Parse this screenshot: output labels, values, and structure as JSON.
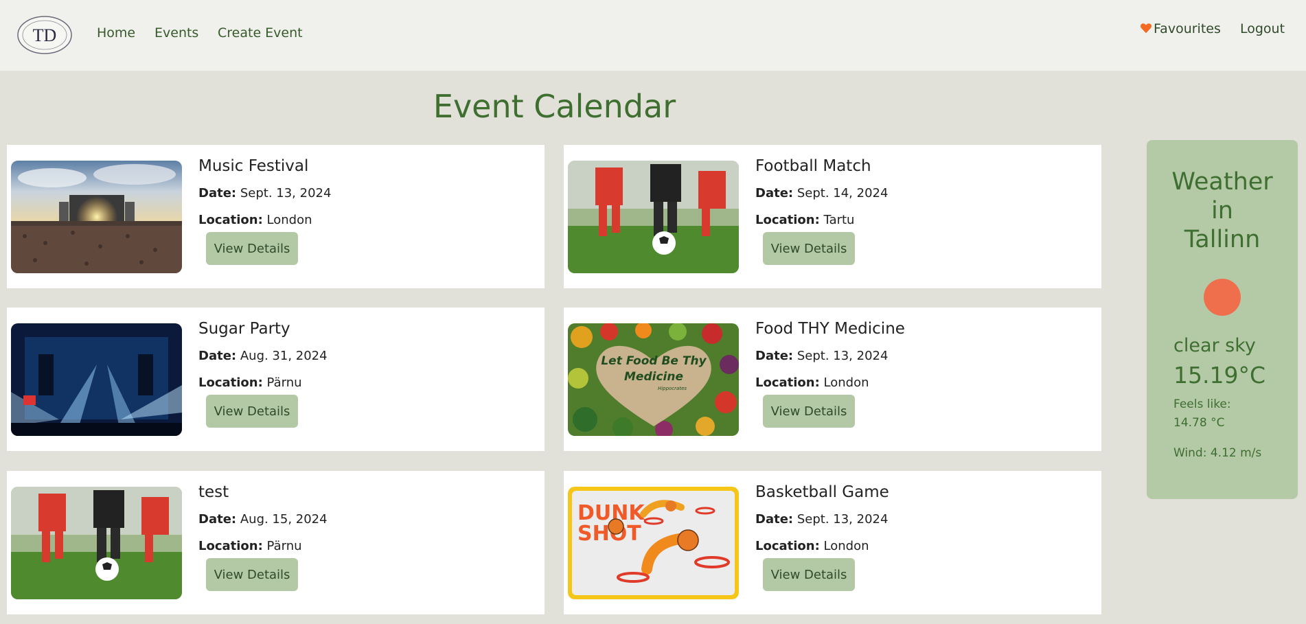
{
  "nav": {
    "logo_text": "TD",
    "links": [
      "Home",
      "Events",
      "Create Event"
    ],
    "favourites": "Favourites",
    "logout": "Logout"
  },
  "page_title": "Event Calendar",
  "labels": {
    "date": "Date:",
    "location": "Location:",
    "button": "View Details"
  },
  "events": [
    {
      "title": "Music Festival",
      "date": "Sept. 13, 2024",
      "location": "London",
      "image": "concert-crowd"
    },
    {
      "title": "Football Match",
      "date": "Sept. 14, 2024",
      "location": "Tartu",
      "image": "football-players"
    },
    {
      "title": "Sugar Party",
      "date": "Aug. 31, 2024",
      "location": "Pärnu",
      "image": "stage-lights"
    },
    {
      "title": "Food THY Medicine",
      "date": "Sept. 13, 2024",
      "location": "London",
      "image": "food-heart",
      "image_text": [
        "Let Food Be Thy",
        "Medicine",
        "Hippocrates"
      ]
    },
    {
      "title": "test",
      "date": "Aug. 15, 2024",
      "location": "Pärnu",
      "image": "football-players"
    },
    {
      "title": "Basketball Game",
      "date": "Sept. 13, 2024",
      "location": "London",
      "image": "dunk-shot",
      "image_text": [
        "DUNK",
        "SHOT"
      ]
    }
  ],
  "weather": {
    "title_lines": [
      "Weather",
      "in",
      "Tallinn"
    ],
    "description": "clear sky",
    "temperature": "15.19°C",
    "feels_like_label": "Feels like:",
    "feels_like_value": "14.78 °C",
    "wind": "Wind: 4.12 m/s",
    "icon": "sun-icon"
  },
  "colors": {
    "accent": "#3e6e30",
    "button": "#b3c9a5",
    "weather_panel": "#b4c9a6",
    "sun": "#ef6f4c",
    "heart": "#f26b21"
  }
}
